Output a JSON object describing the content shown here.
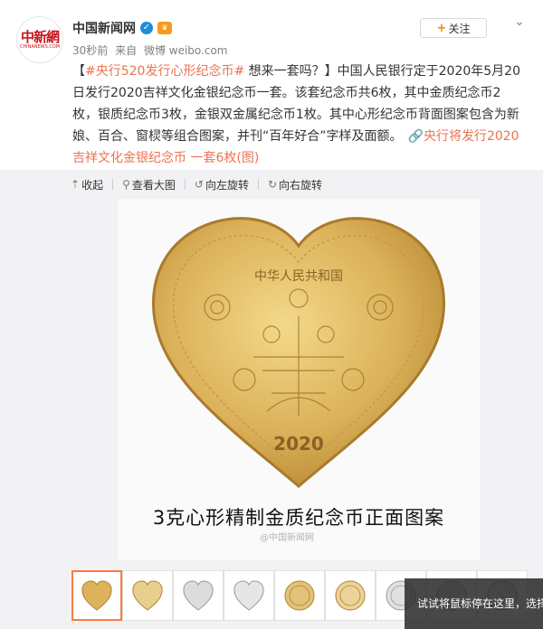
{
  "author": {
    "name": "中国新闻网",
    "logo_cn": "中新網",
    "logo_en": "CHINANEWS.COM"
  },
  "meta": {
    "time": "30秒前",
    "source_prefix": "来自",
    "source": "微博 weibo.com"
  },
  "follow_label": "关注",
  "post": {
    "bracket_open": "【",
    "hashtag": "#央行520发行心形纪念币#",
    "headline_rest": " 想来一套吗？】",
    "body": "中国人民银行定于2020年5月20日发行2020吉祥文化金银纪念币一套。该套纪念币共6枚，其中金质纪念币2枚，银质纪念币3枚，金银双金属纪念币1枚。其中心形纪念币背面图案包含为新娘、百合、窗棂等组合图案，并刊“百年好合”字样及面额。",
    "link_text": "央行将发行2020吉祥文化金银纪念币 一套6枚(图)"
  },
  "toolbar": {
    "collapse": "收起",
    "view_large": "查看大图",
    "rotate_left": "向左旋转",
    "rotate_right": "向右旋转"
  },
  "image": {
    "caption": "3克心形精制金质纪念币正面图案",
    "coin_inscription_top": "中华人民共和国",
    "coin_year": "2020",
    "watermark": "@中国新闻网"
  },
  "thumbnails": [
    {
      "kind": "gold-heart",
      "active": true
    },
    {
      "kind": "gold-heart"
    },
    {
      "kind": "silver-heart"
    },
    {
      "kind": "silver-heart"
    },
    {
      "kind": "gold-round"
    },
    {
      "kind": "gold-round"
    },
    {
      "kind": "silver-round"
    },
    {
      "kind": "silver-round"
    },
    {
      "kind": "silver-round"
    }
  ],
  "toast": "试试将鼠标停在这里，选择",
  "colors": {
    "link": "#eb7350",
    "gold": "#d6a94a",
    "active_border": "#fa7d3c"
  }
}
